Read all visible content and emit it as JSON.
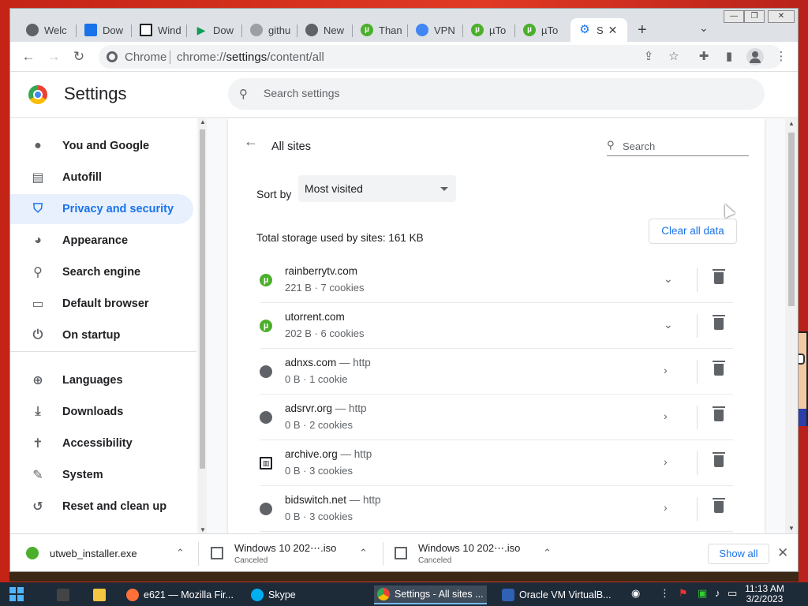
{
  "tabs": [
    {
      "label": "Welc",
      "icon": "globe-icon",
      "color": "#5f6368"
    },
    {
      "label": "Dow",
      "icon": "picture-icon",
      "color": "#1a73e8"
    },
    {
      "label": "Wind",
      "icon": "archive-icon",
      "color": "#202124"
    },
    {
      "label": "Dow",
      "icon": "play-icon",
      "color": "#0f9d58"
    },
    {
      "label": "githu",
      "icon": "globe-icon",
      "color": "#5f6368"
    },
    {
      "label": "New",
      "icon": "chrome-icon",
      "color": "#5f6368"
    },
    {
      "label": "Than",
      "icon": "utorrent-icon",
      "color": "#4caf2c"
    },
    {
      "label": "VPN",
      "icon": "vpn-icon",
      "color": "#4285f4"
    },
    {
      "label": "µTo",
      "icon": "utorrent-icon",
      "color": "#4caf2c"
    },
    {
      "label": "µTo",
      "icon": "utorrent-icon",
      "color": "#4caf2c"
    }
  ],
  "active_tab": {
    "label": "S",
    "icon": "settings-gear-icon"
  },
  "omnibox": {
    "site_label": "Chrome",
    "url_prefix": "chrome://",
    "url_host": "settings",
    "url_path": "/content/all"
  },
  "header": {
    "title": "Settings",
    "search_placeholder": "Search settings"
  },
  "sidebar": {
    "items": [
      {
        "label": "You and Google",
        "icon": "person-icon"
      },
      {
        "label": "Autofill",
        "icon": "clipboard-icon"
      },
      {
        "label": "Privacy and security",
        "icon": "shield-icon",
        "active": true
      },
      {
        "label": "Appearance",
        "icon": "palette-icon"
      },
      {
        "label": "Search engine",
        "icon": "search-icon"
      },
      {
        "label": "Default browser",
        "icon": "browser-icon"
      },
      {
        "label": "On startup",
        "icon": "power-icon"
      },
      {
        "label": "Languages",
        "icon": "globe-icon"
      },
      {
        "label": "Downloads",
        "icon": "download-icon"
      },
      {
        "label": "Accessibility",
        "icon": "accessibility-icon"
      },
      {
        "label": "System",
        "icon": "wrench-icon"
      },
      {
        "label": "Reset and clean up",
        "icon": "history-icon"
      }
    ]
  },
  "all_sites": {
    "title": "All sites",
    "search_placeholder": "Search",
    "sort_label": "Sort by",
    "sort_value": "Most visited",
    "storage_text": "Total storage used by sites: 161 KB",
    "clear_button": "Clear all data",
    "sites": [
      {
        "name": "rainberrytv.com",
        "proto": "",
        "detail": "221 B · 7 cookies",
        "icon": "utorrent-icon",
        "expand": "chevron-down"
      },
      {
        "name": "utorrent.com",
        "proto": "",
        "detail": "202 B · 6 cookies",
        "icon": "utorrent-icon",
        "expand": "chevron-down"
      },
      {
        "name": "adnxs.com",
        "proto": " — http",
        "detail": "0 B · 1 cookie",
        "icon": "globe-icon",
        "expand": "chevron-right"
      },
      {
        "name": "adsrvr.org",
        "proto": " — http",
        "detail": "0 B · 2 cookies",
        "icon": "globe-icon",
        "expand": "chevron-right"
      },
      {
        "name": "archive.org",
        "proto": " — http",
        "detail": "0 B · 3 cookies",
        "icon": "archive-icon",
        "expand": "chevron-right"
      },
      {
        "name": "bidswitch.net",
        "proto": " — http",
        "detail": "0 B · 3 cookies",
        "icon": "globe-icon",
        "expand": "chevron-right"
      }
    ]
  },
  "downloads": [
    {
      "name": "utweb_installer.exe",
      "status": "",
      "icon": "utorrent-icon"
    },
    {
      "name": "Windows 10  202⋯.iso",
      "status": "Canceled",
      "icon": "disc-image-icon"
    },
    {
      "name": "Windows 10  202⋯.iso",
      "status": "Canceled",
      "icon": "disc-image-icon"
    }
  ],
  "download_bar": {
    "show_all": "Show all"
  },
  "taskbar": {
    "apps": [
      {
        "label": "",
        "icon": "calculator-icon"
      },
      {
        "label": "",
        "icon": "folder-icon"
      },
      {
        "label": "e621 — Mozilla Fir...",
        "icon": "firefox-icon"
      },
      {
        "label": "Skype",
        "icon": "skype-icon"
      },
      {
        "label": "Settings - All sites ...",
        "icon": "chrome-icon"
      },
      {
        "label": "Oracle VM VirtualB...",
        "icon": "virtualbox-icon"
      }
    ],
    "time": "11:13 AM",
    "date": "3/2/2023"
  },
  "colors": {
    "accent": "#1a73e8",
    "active_bg": "#e8f0fe",
    "utorrent": "#4caf2c"
  }
}
